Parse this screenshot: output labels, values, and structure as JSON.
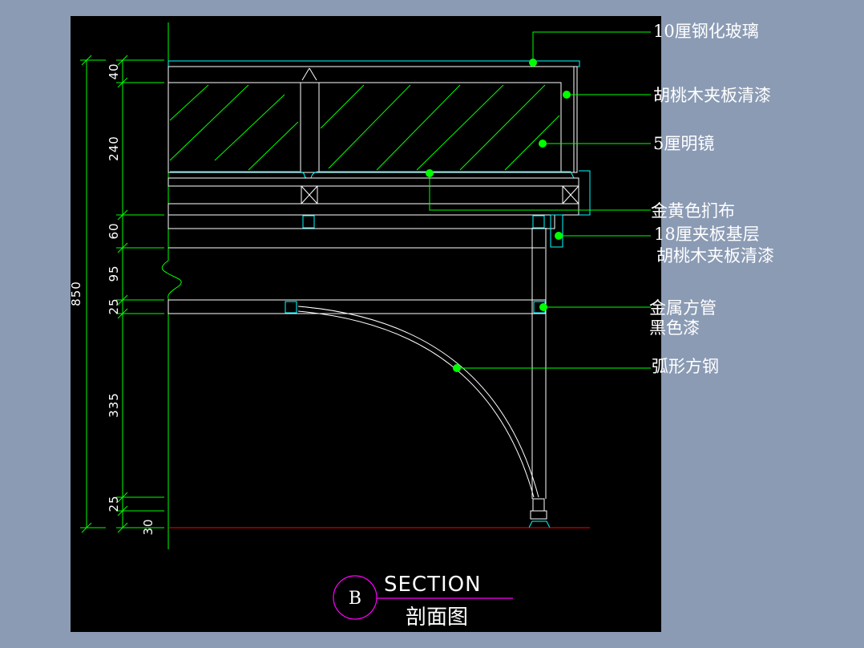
{
  "drawing": {
    "title": "SECTION",
    "title_cn": "剖面图",
    "marker": "B",
    "colors": {
      "background": "#000000",
      "frame_bg": "#8b9bb4",
      "leader": "#00ff00",
      "outline": "#ffffff",
      "glass": "#00ffff",
      "floor": "#ff0000",
      "marker": "#ff00ff"
    },
    "overall_dimension": "850",
    "dimensions": [
      "40",
      "240",
      "60",
      "95",
      "25",
      "335",
      "25",
      "30"
    ],
    "labels": [
      "10厘钢化玻璃",
      "胡桃木夹板清漆",
      "5厘明镜",
      "金黄色扪布",
      "18厘夹板基层",
      "胡桃木夹板清漆",
      "金属方管",
      "黑色漆",
      "弧形方钢"
    ]
  }
}
